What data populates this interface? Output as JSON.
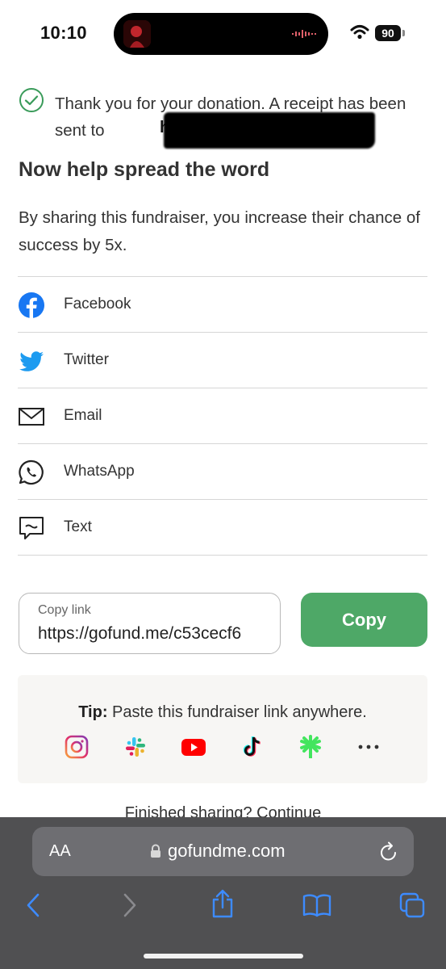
{
  "status_bar": {
    "time": "10:10",
    "battery": "90"
  },
  "notice": {
    "text": "Thank you for your donation. A receipt has been sent to",
    "redacted_visible": "hunt"
  },
  "heading": "Now help spread the word",
  "subtext": "By sharing this fundraiser, you increase their chance of success by 5x.",
  "share_options": [
    {
      "label": "Facebook",
      "icon": "facebook-icon"
    },
    {
      "label": "Twitter",
      "icon": "twitter-icon"
    },
    {
      "label": "Email",
      "icon": "envelope-icon"
    },
    {
      "label": "WhatsApp",
      "icon": "whatsapp-icon"
    },
    {
      "label": "Text",
      "icon": "message-bubble-icon"
    }
  ],
  "copy_link": {
    "label": "Copy link",
    "value": "https://gofund.me/c53cecf6",
    "button": "Copy"
  },
  "tip": {
    "bold": "Tip:",
    "text": " Paste this fundraiser link anywhere.",
    "icons": [
      "instagram-icon",
      "slack-icon",
      "youtube-icon",
      "tiktok-icon",
      "linktree-icon",
      "more-icon"
    ]
  },
  "finished": "Finished sharing? Continue",
  "browser": {
    "aa_label": "AA",
    "url": "gofundme.com"
  },
  "colors": {
    "accent_green": "#4ea867",
    "check_green": "#3a9b5a",
    "facebook_blue": "#1877f2",
    "twitter_blue": "#1d9bf0",
    "browser_blue": "#3d8bff",
    "browser_bg": "#505052"
  }
}
